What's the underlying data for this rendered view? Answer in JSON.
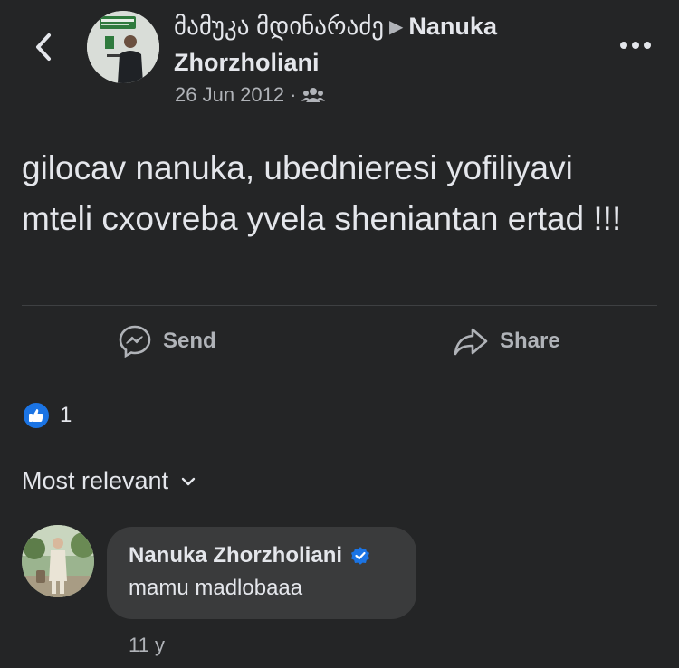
{
  "header": {
    "back_icon": "chevron-left-icon",
    "author_name": "მამუკა მდინარაძე",
    "target_name": "Nanuka Zhorzholiani",
    "arrow_glyph": "▶",
    "date": "26 Jun 2012",
    "separator": "·",
    "audience_icon": "friends-icon",
    "more_icon": "more-horizontal-icon"
  },
  "post": {
    "text": "gilocav nanuka, ubednieresi yofiliyavi mteli cxovreba yvela sheniantan ertad !!!"
  },
  "actions": {
    "send_label": "Send",
    "share_label": "Share"
  },
  "reactions": {
    "count": "1",
    "type": "like"
  },
  "comments_header": {
    "sort_label": "Most relevant"
  },
  "comments": [
    {
      "author": "Nanuka Zhorzholiani",
      "verified": true,
      "text": "mamu madlobaaa",
      "time": "11 y"
    }
  ],
  "colors": {
    "background": "#242526",
    "bubble": "#3a3b3c",
    "accent": "#1b74e4",
    "text_primary": "#e4e6eb",
    "text_secondary": "#b0b3b8"
  }
}
